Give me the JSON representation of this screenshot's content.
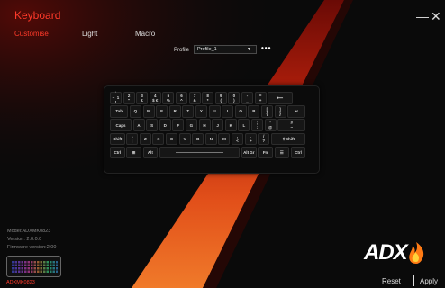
{
  "app": {
    "title": "Keyboard"
  },
  "window": {
    "minimize": "—",
    "close": "✕"
  },
  "tabs": [
    {
      "label": "Customise",
      "active": true
    },
    {
      "label": "Light",
      "active": false
    },
    {
      "label": "Macro",
      "active": false
    }
  ],
  "profile": {
    "label": "Profile",
    "value": "Profile_1",
    "more": "•••"
  },
  "keyboard": {
    "rows": [
      [
        "`\n~  1\n!",
        "2\n\"",
        "3\n£",
        "4\n$ €",
        "5\n%",
        "6\n^",
        "7\n&",
        "8\n*",
        "9\n(",
        "0\n)",
        "-\n_",
        "=\n+",
        "⟵"
      ],
      [
        "Tab",
        "Q",
        "W",
        "E",
        "R",
        "T",
        "Y",
        "U",
        "I",
        "O",
        "P",
        "[\n{",
        "]\n}",
        "↵"
      ],
      [
        "Caps",
        "A",
        "S",
        "D",
        "F",
        "G",
        "H",
        "J",
        "K",
        "L",
        ";\n:",
        "'\n@",
        "#\n~"
      ],
      [
        "Shift",
        "\\\n|",
        "Z",
        "X",
        "C",
        "V",
        "B",
        "N",
        "M",
        ",\n<",
        ".\n>",
        "/\n?",
        "⇧Shift"
      ],
      [
        "Ctrl",
        "⊞",
        "Alt",
        "",
        "Alt Gr",
        "Fn",
        "☰",
        "Ctrl"
      ]
    ]
  },
  "device": {
    "model": "Model:ADXMK0823",
    "version": "Version: 2.0.0.0",
    "firmware": "Firmware version:2.00",
    "thumbnail_label": "ADXMK0823"
  },
  "brand": {
    "logo": "ADX"
  },
  "footer": {
    "reset": "Reset",
    "apply": "Apply"
  },
  "colors": {
    "accent": "#ff3a2a",
    "background": "#0a0a0a"
  }
}
